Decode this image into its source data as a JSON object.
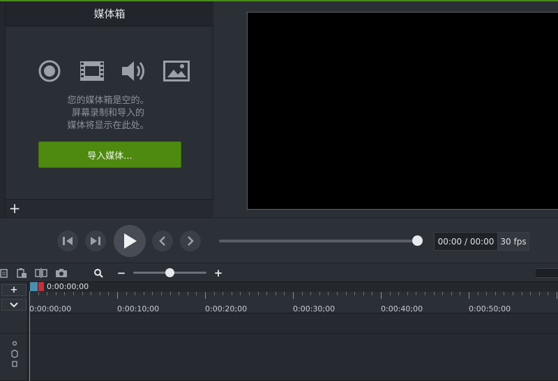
{
  "media_bin": {
    "title": "媒体箱",
    "icons": [
      "record-icon",
      "film-icon",
      "audio-icon",
      "image-icon"
    ],
    "empty_lines": [
      "您的媒体箱是空的。",
      "屏幕录制和导入的",
      "媒体将显示在此处。"
    ],
    "import_button": "导入媒体...",
    "add_label": "+"
  },
  "playback": {
    "time": "00:00 / 00:00",
    "fps": "30 fps",
    "buttons": [
      "previous-frame",
      "next-frame",
      "play",
      "previous-marker",
      "next-marker"
    ],
    "progress": 1.0
  },
  "timeline": {
    "toolbar_icons": [
      "copy-icon",
      "paste-icon",
      "split-icon",
      "snapshot-icon",
      "search-icon"
    ],
    "zoom_minus": "−",
    "zoom_plus": "+",
    "zoom_level": 0.5,
    "playhead_time": "0:00:00;00",
    "add_track": "+",
    "collapse": "⌄",
    "ruler_labels": [
      "0:00:00;00",
      "0:00:10;00",
      "0:00:20;00",
      "0:00:30;00",
      "0:00:40;00",
      "0:00:50;00"
    ]
  },
  "colors": {
    "accent_green": "#4e8a0f",
    "playhead_blue": "#4a8fb0",
    "playhead_red": "#c0323a"
  }
}
